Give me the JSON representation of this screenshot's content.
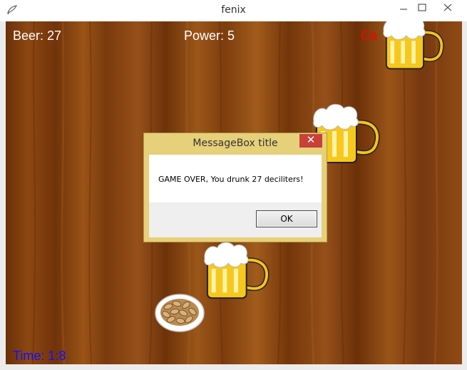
{
  "window": {
    "title": "fenix",
    "icon": "fenix-app-icon",
    "controls": [
      "minimize-icon",
      "maximize-icon",
      "close-icon"
    ]
  },
  "hud": {
    "beer": "Beer: 27",
    "power": "Power: 5",
    "calories": "Ca",
    "time": "Time: 1:8"
  },
  "sprites": [
    "beer-mug",
    "beer-mug",
    "beer-mug",
    "peanut-bowl"
  ],
  "messagebox": {
    "title": "MessageBox title",
    "close_glyph": "✕",
    "text": "GAME OVER, You drunk 27 deciliters!",
    "ok_label": "OK"
  },
  "colors": {
    "hud_text": "#ffffff",
    "calories_text": "#ff0000",
    "time_text": "#1010ff",
    "wood": "#8a4510",
    "messagebox_frame": "#e7d07a",
    "close_button": "#c8403a"
  }
}
